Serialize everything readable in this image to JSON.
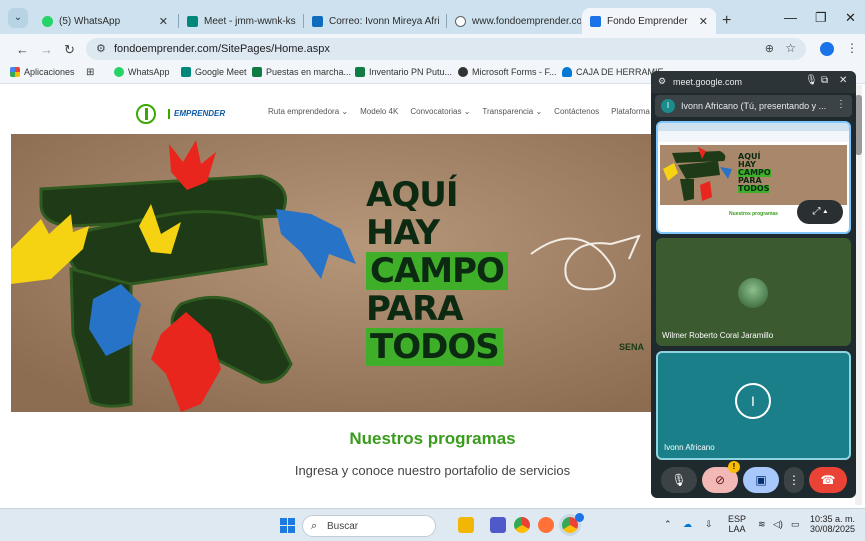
{
  "tabs": [
    {
      "label": "(5) WhatsApp",
      "icon": "whatsapp-icon",
      "color": "#25d366"
    },
    {
      "label": "Meet - jmm-wwnk-ks",
      "icon": "meet-icon",
      "color": "#00897b"
    },
    {
      "label": "Correo: Ivonn Mireya Afri",
      "icon": "outlook-icon",
      "color": "#0f6cbd"
    },
    {
      "label": "www.fondoemprender.co",
      "icon": "globe-icon",
      "color": "#5f6368"
    },
    {
      "label": "Fondo Emprender",
      "icon": "fondo-emprender-icon",
      "color": "#1a73e8"
    }
  ],
  "address": {
    "url": "fondoemprender.com/SitePages/Home.aspx"
  },
  "bookmarks": [
    {
      "label": "Aplicaciones",
      "color": "#ea4335"
    },
    {
      "label": "WhatsApp",
      "color": "#25d366"
    },
    {
      "label": "Google Meet",
      "color": "#00897b"
    },
    {
      "label": "Puestas en marcha...",
      "color": "#107c41"
    },
    {
      "label": "Inventario PN Putu...",
      "color": "#107c41"
    },
    {
      "label": "Microsoft Forms - F...",
      "color": "#333333"
    },
    {
      "label": "CAJA DE HERRAMIE...",
      "color": "#0078d4"
    }
  ],
  "site": {
    "logo_text": "EMPRENDER",
    "nav": [
      "Ruta emprendedora ⌄",
      "Modelo 4K",
      "Convocatorias ⌄",
      "Transparencia ⌄",
      "Contáctenos",
      "Plataforma"
    ],
    "hero": {
      "lines": [
        "AQUÍ",
        "HAY",
        "CAMPO",
        "PARA",
        "TODOS"
      ],
      "brand": "SENA"
    },
    "programs_title": "Nuestros programas",
    "programs_sub": "Ingresa y conoce nuestro portafolio de servicios"
  },
  "pip": {
    "title": "meet.google.com",
    "presenter_initial": "I",
    "presenter": "Ivonn Africano (Tú, presentando y ...",
    "participants": [
      {
        "name": "Wilmer Roberto Coral Jaramillo"
      },
      {
        "name": "Ivonn Africano",
        "initial": "I"
      }
    ],
    "preview": {
      "lines": [
        "AQUÍ",
        "HAY",
        "CAMPO",
        "PARA",
        "TODOS"
      ],
      "caption": "Nuestros programas"
    }
  },
  "taskbar": {
    "search": "Buscar",
    "lang_top": "ESP",
    "lang_bottom": "LAA",
    "time": "10:35 a. m.",
    "date": "30/08/2025"
  },
  "colors": {
    "accent": "#1a73e8",
    "brand_green": "#3fae29",
    "end_call": "#ea4335"
  }
}
